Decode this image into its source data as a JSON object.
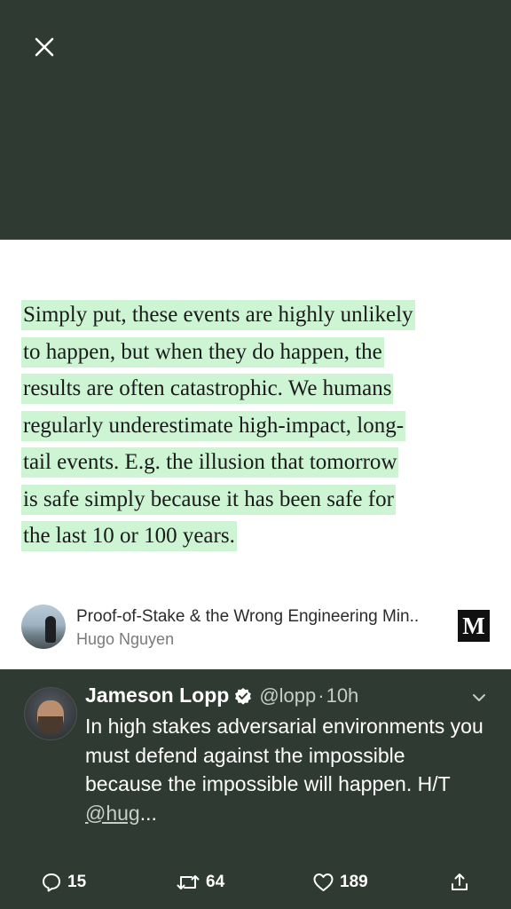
{
  "viewer": {
    "close_icon": "close-icon"
  },
  "media": {
    "quote_lines": [
      "Simply put, these events are highly unlikely",
      "to happen, but when they do happen, the",
      "results are often catastrophic. We humans",
      "regularly underestimate high-impact, long-",
      "tail events. E.g. the illusion that tomorrow",
      "is safe simply because it has been safe for",
      "the last 10 or 100 years."
    ],
    "highlight_color": "#cdf5d4",
    "link": {
      "title": "Proof-of-Stake & the Wrong Engineering Min..",
      "author": "Hugo Nguyen",
      "logo_text": "M"
    }
  },
  "tweet": {
    "display_name": "Jameson Lopp",
    "handle": "@lopp",
    "separator": "·",
    "time": "10h",
    "text": "In high stakes adversarial environments you must defend against the impossible because the impossible will happen. H/T ",
    "mention": "@hug",
    "ellipsis": "...",
    "actions": {
      "replies": "15",
      "retweets": "64",
      "likes": "189"
    }
  },
  "colors": {
    "background": "#2f3a32",
    "card": "#ffffff",
    "text_primary": "#ffffff",
    "text_secondary": "#c7cdc8"
  }
}
